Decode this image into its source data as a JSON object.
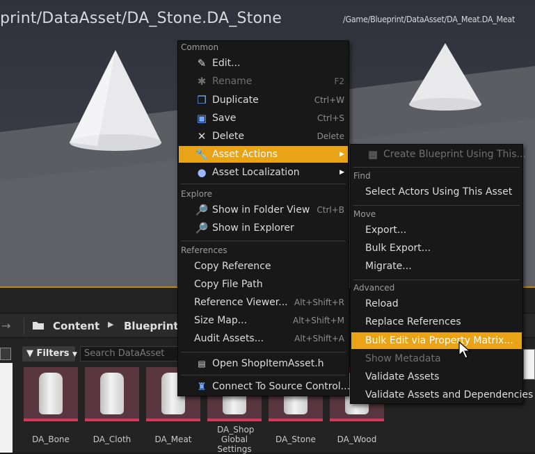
{
  "viewport": {
    "label_left": "print/DataAsset/DA_Stone.DA_Stone",
    "label_right": "/Game/Blueprint/DataAsset/DA_Meat.DA_Meat"
  },
  "content_browser": {
    "breadcrumbs": [
      "Content",
      "Blueprint"
    ],
    "filters_label": "Filters",
    "search_placeholder": "Search DataAsset",
    "assets": [
      {
        "label": "DA_Bone"
      },
      {
        "label": "DA_Cloth"
      },
      {
        "label": "DA_Meat"
      },
      {
        "label": "DA_Shop Global Settings"
      },
      {
        "label": "DA_Stone"
      },
      {
        "label": "DA_Wood"
      }
    ]
  },
  "context_menu": {
    "sections": {
      "common": "Common",
      "explore": "Explore",
      "references": "References"
    },
    "items": {
      "edit": {
        "label": "Edit...",
        "shortcut": ""
      },
      "rename": {
        "label": "Rename",
        "shortcut": "F2"
      },
      "duplicate": {
        "label": "Duplicate",
        "shortcut": "Ctrl+W"
      },
      "save": {
        "label": "Save",
        "shortcut": "Ctrl+S"
      },
      "delete": {
        "label": "Delete",
        "shortcut": "Delete"
      },
      "asset_actions": {
        "label": "Asset Actions"
      },
      "asset_localization": {
        "label": "Asset Localization"
      },
      "show_in_folder_view": {
        "label": "Show in Folder View",
        "shortcut": "Ctrl+B"
      },
      "show_in_explorer": {
        "label": "Show in Explorer"
      },
      "copy_reference": {
        "label": "Copy Reference"
      },
      "copy_file_path": {
        "label": "Copy File Path"
      },
      "reference_viewer": {
        "label": "Reference Viewer...",
        "shortcut": "Alt+Shift+R"
      },
      "size_map": {
        "label": "Size Map...",
        "shortcut": "Alt+Shift+M"
      },
      "audit_assets": {
        "label": "Audit Assets...",
        "shortcut": "Alt+Shift+A"
      },
      "open_source": {
        "label": "Open ShopItemAsset.h"
      },
      "connect_source_control": {
        "label": "Connect To Source Control..."
      }
    }
  },
  "submenu": {
    "sections": {
      "find": "Find",
      "move": "Move",
      "advanced": "Advanced"
    },
    "items": {
      "create_blueprint": "Create Blueprint Using This...",
      "select_actors": "Select Actors Using This Asset",
      "export": "Export...",
      "bulk_export": "Bulk Export...",
      "migrate": "Migrate...",
      "reload": "Reload",
      "replace_references": "Replace References",
      "bulk_edit": "Bulk Edit via Property Matrix...",
      "show_metadata": "Show Metadata",
      "validate_assets": "Validate Assets",
      "validate_assets_deps": "Validate Assets and Dependencies"
    }
  },
  "colors": {
    "highlight": "#e8a317",
    "menu_bg": "#181818",
    "asset_tile": "#5a3740",
    "asset_bar": "#d23a5a"
  }
}
